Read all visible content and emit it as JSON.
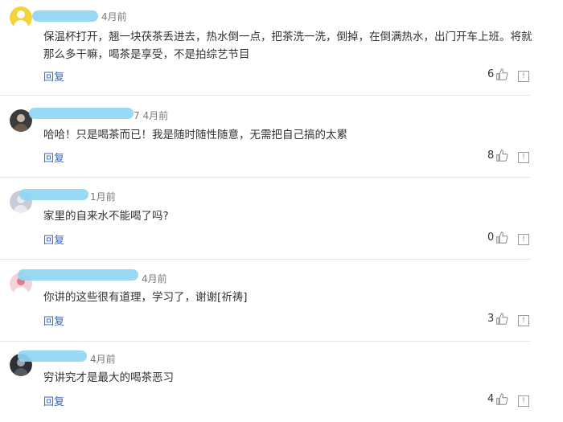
{
  "reply_label": "回复",
  "comments": [
    {
      "time": "4月前",
      "text": "保温杯打开，翘一块茯茶丢进去，热水倒一点，把茶洗一洗，倒掉，在倒满热水，出门开车上班。将就那么多干嘛，喝茶是享受，不是拍综艺节目",
      "likes": "6"
    },
    {
      "time": "7 4月前",
      "text": "哈哈！只是喝茶而已！我是随时随性随意，无需把自己搞的太累",
      "likes": "8"
    },
    {
      "time": "1月前",
      "text": "家里的自来水不能喝了吗?",
      "likes": "0"
    },
    {
      "time": "4月前",
      "text": "你讲的这些很有道理，学习了，谢谢[祈祷]",
      "likes": "3"
    },
    {
      "time": "4月前",
      "text": "穷讲究才是最大的喝茶恶习",
      "likes": "4"
    }
  ],
  "colors": {
    "reply_link": "#3a66b8",
    "name_redaction": "#8fd6f3",
    "divider": "#e6e6e6"
  },
  "icons": {
    "like": "thumbs-up-icon",
    "report": "report-icon"
  }
}
